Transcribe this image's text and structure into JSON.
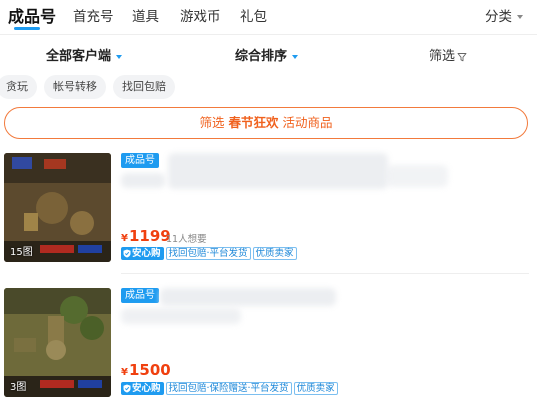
{
  "topnav": {
    "tabs": [
      {
        "label": "成品号",
        "active": true
      },
      {
        "label": "首充号"
      },
      {
        "label": "道具"
      },
      {
        "label": "游戏币"
      },
      {
        "label": "礼包"
      }
    ],
    "category": {
      "label": "分类"
    }
  },
  "sortbar": {
    "client": "全部客户端",
    "order": "综合排序",
    "filter": "筛选"
  },
  "chips": [
    "贪玩",
    "帐号转移",
    "找回包赔"
  ],
  "promo": {
    "prefix": "筛选",
    "highlight": "春节狂欢",
    "suffix": "活动商品"
  },
  "colors": {
    "accent": "#1e9bf0",
    "price": "#f0400f",
    "promo": "#f0611d"
  },
  "listings": [
    {
      "badge": "成品号",
      "image_count": "15图",
      "price_symbol": "¥",
      "price": "1199",
      "wants": "11人想要",
      "safe_label": "安心购",
      "tags": [
        "找回包赔·平台发货",
        "优质卖家"
      ]
    },
    {
      "badge": "成品号",
      "image_count": "3图",
      "price_symbol": "¥",
      "price": "1500",
      "wants": "",
      "safe_label": "安心购",
      "tags": [
        "找回包赔·保险赠送·平台发货",
        "优质卖家"
      ]
    }
  ]
}
